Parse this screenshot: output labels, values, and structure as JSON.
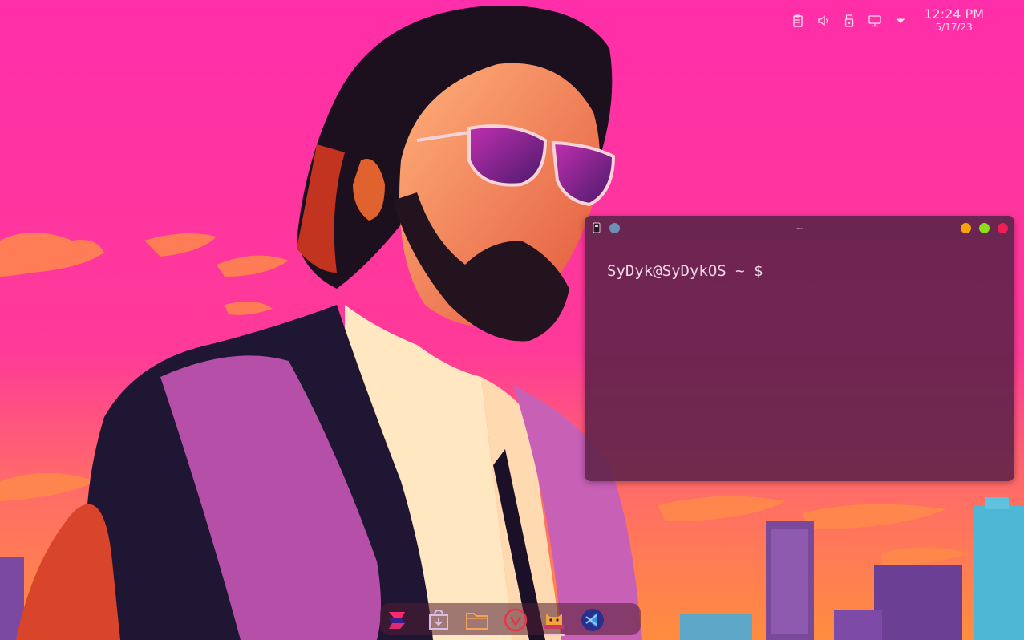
{
  "tray": {
    "icons": [
      "clipboard-icon",
      "volume-icon",
      "usb-drive-icon",
      "network-icon",
      "tray-expand-icon"
    ],
    "time": "12:24 PM",
    "date": "5/17/23"
  },
  "terminal": {
    "title": "~",
    "prompt": "SyDyk@SyDykOS ~ $",
    "buttons": [
      "minimize",
      "maximize",
      "close"
    ],
    "colors": {
      "minimize": "#f5a30d",
      "maximize": "#8ae01a",
      "close": "#ee1f57",
      "pin": "#6b8fb5"
    }
  },
  "dock": {
    "items": [
      {
        "name": "app-launcher",
        "icon": "launcher-logo-icon",
        "running": false
      },
      {
        "name": "software-store",
        "icon": "store-download-icon",
        "running": false
      },
      {
        "name": "file-manager",
        "icon": "folder-icon",
        "running": false
      },
      {
        "name": "vivaldi-browser",
        "icon": "vivaldi-icon",
        "running": false
      },
      {
        "name": "terminal",
        "icon": "terminal-cat-icon",
        "running": true
      },
      {
        "name": "vscode",
        "icon": "vscode-icon",
        "running": false
      }
    ]
  }
}
